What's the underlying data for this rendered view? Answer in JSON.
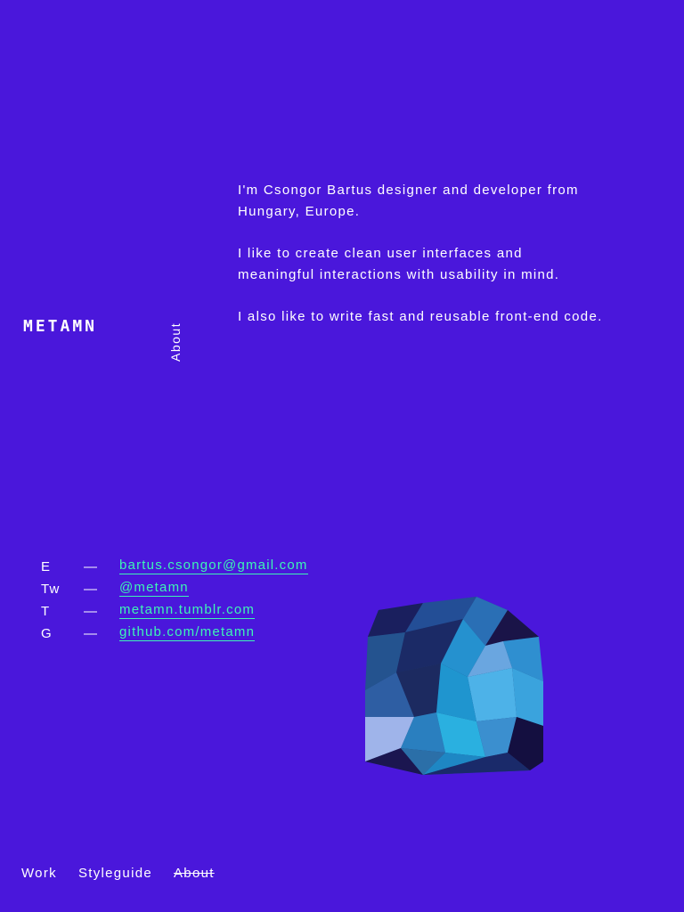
{
  "brand": {
    "logo_text": "METAMN"
  },
  "section": {
    "label": "About"
  },
  "bio": {
    "paragraphs": [
      "I'm Csongor Bartus designer and developer from Hungary, Europe.",
      "I like to create clean user interfaces and meaningful interactions with usability in mind.",
      "I also like to write fast and reusable front-end code."
    ]
  },
  "contacts": [
    {
      "key": "E",
      "dash": "—",
      "value": "bartus.csongor@gmail.com"
    },
    {
      "key": "Tw",
      "dash": "—",
      "value": "@metamn"
    },
    {
      "key": "T",
      "dash": "—",
      "value": "metamn.tumblr.com"
    },
    {
      "key": "G",
      "dash": "—",
      "value": "github.com/metamn"
    }
  ],
  "footer_nav": {
    "items": [
      {
        "label": "Work"
      },
      {
        "label": "Styleguide"
      },
      {
        "label": "About"
      }
    ]
  },
  "colors": {
    "background": "#4a17db",
    "text": "#ffffff",
    "link": "#3df5b5"
  },
  "icons": {
    "gem": "low-poly-gem-illustration"
  }
}
